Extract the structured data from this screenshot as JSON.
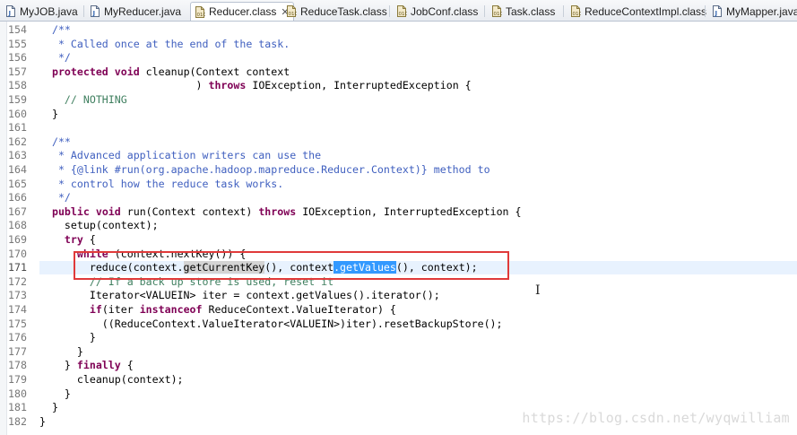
{
  "tabs": [
    {
      "name": "MyJOB.java",
      "type": "java"
    },
    {
      "name": "MyReducer.java",
      "type": "java"
    },
    {
      "name": "Reducer.class",
      "type": "class",
      "active": true,
      "close": "✕"
    },
    {
      "name": "ReduceTask.class",
      "type": "class"
    },
    {
      "name": "JobConf.class",
      "type": "class"
    },
    {
      "name": "Task.class",
      "type": "class"
    },
    {
      "name": "ReduceContextImpl.class",
      "type": "class"
    },
    {
      "name": "MyMapper.java",
      "type": "java"
    }
  ],
  "lines": [
    {
      "n": "154",
      "t": "  /**"
    },
    {
      "n": "155",
      "t": "   * Called once at the end of the task."
    },
    {
      "n": "156",
      "t": "   */"
    },
    {
      "n": "157",
      "t": "  protected void cleanup(Context context"
    },
    {
      "n": "158",
      "t": "                         ) throws IOException, InterruptedException {"
    },
    {
      "n": "159",
      "t": "    // NOTHING"
    },
    {
      "n": "160",
      "t": "  }"
    },
    {
      "n": "161",
      "t": ""
    },
    {
      "n": "162",
      "t": "  /**"
    },
    {
      "n": "163",
      "t": "   * Advanced application writers can use the"
    },
    {
      "n": "164",
      "t": "   * {@link #run(org.apache.hadoop.mapreduce.Reducer.Context)} method to"
    },
    {
      "n": "165",
      "t": "   * control how the reduce task works."
    },
    {
      "n": "166",
      "t": "   */"
    },
    {
      "n": "167",
      "t": "  public void run(Context context) throws IOException, InterruptedException {"
    },
    {
      "n": "168",
      "t": "    setup(context);"
    },
    {
      "n": "169",
      "t": "    try {"
    },
    {
      "n": "170",
      "t": "      while (context.nextKey()) {"
    },
    {
      "n": "171",
      "t": "        reduce(context.getCurrentKey(), context.getValues(), context);"
    },
    {
      "n": "172",
      "t": "        // If a back up store is used, reset it"
    },
    {
      "n": "173",
      "t": "        Iterator<VALUEIN> iter = context.getValues().iterator();"
    },
    {
      "n": "174",
      "t": "        if(iter instanceof ReduceContext.ValueIterator) {"
    },
    {
      "n": "175",
      "t": "          ((ReduceContext.ValueIterator<VALUEIN>)iter).resetBackupStore();"
    },
    {
      "n": "176",
      "t": "        }"
    },
    {
      "n": "177",
      "t": "      }"
    },
    {
      "n": "178",
      "t": "    } finally {"
    },
    {
      "n": "179",
      "t": "      cleanup(context);"
    },
    {
      "n": "180",
      "t": "    }"
    },
    {
      "n": "181",
      "t": "  }"
    },
    {
      "n": "182",
      "t": "}"
    }
  ],
  "highlight_line": "171",
  "selection_gray": "getCurrentKey",
  "selection_blue": ".getValues",
  "watermark": "https://blog.csdn.net/wyqwilliam",
  "colors": {
    "keyword": "#7f0055",
    "javadoc": "#3f5fbf",
    "comment": "#3f7f5f",
    "annotation_box": "#e03a3a",
    "selection": "#3399ff"
  }
}
